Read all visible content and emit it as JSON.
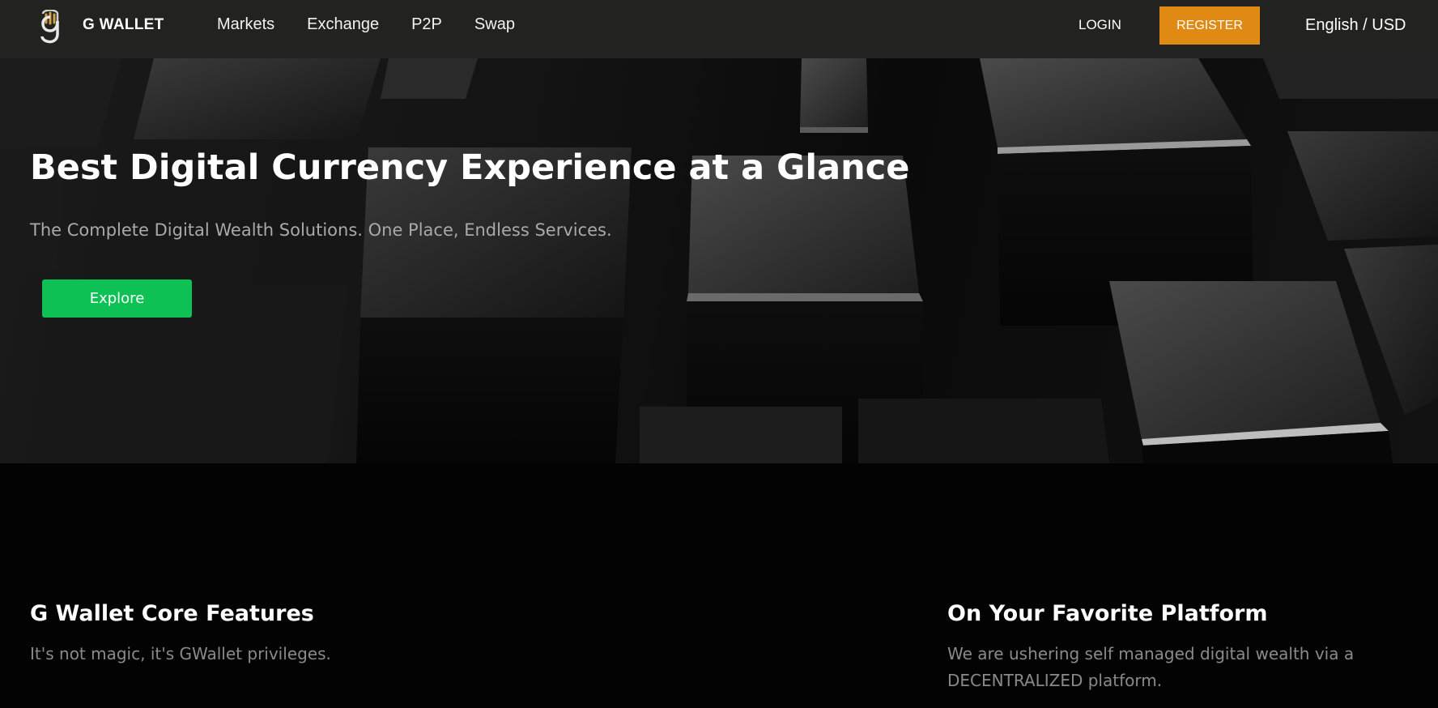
{
  "nav": {
    "brand": "G WALLET",
    "menu": [
      "Markets",
      "Exchange",
      "P2P",
      "Swap"
    ],
    "login": "LOGIN",
    "register": "REGISTER",
    "language": "English / USD"
  },
  "hero": {
    "title": "Best Digital Currency Experience at a Glance",
    "subtitle": "The Complete Digital Wealth Solutions. One Place, Endless Services.",
    "cta": "Explore"
  },
  "features": {
    "left": {
      "title": "G Wallet Core Features",
      "text": "It's not magic, it's GWallet privileges."
    },
    "right": {
      "title": "On Your Favorite Platform",
      "text": "We are ushering self managed digital wealth via a DECENTRALIZED platform."
    }
  },
  "colors": {
    "nav_bg": "#222220",
    "register": "#e08a14",
    "explore": "#0ec154",
    "logo_accent": "#d4a24a"
  },
  "icons": {
    "logo": "g-wallet-logo-icon"
  }
}
